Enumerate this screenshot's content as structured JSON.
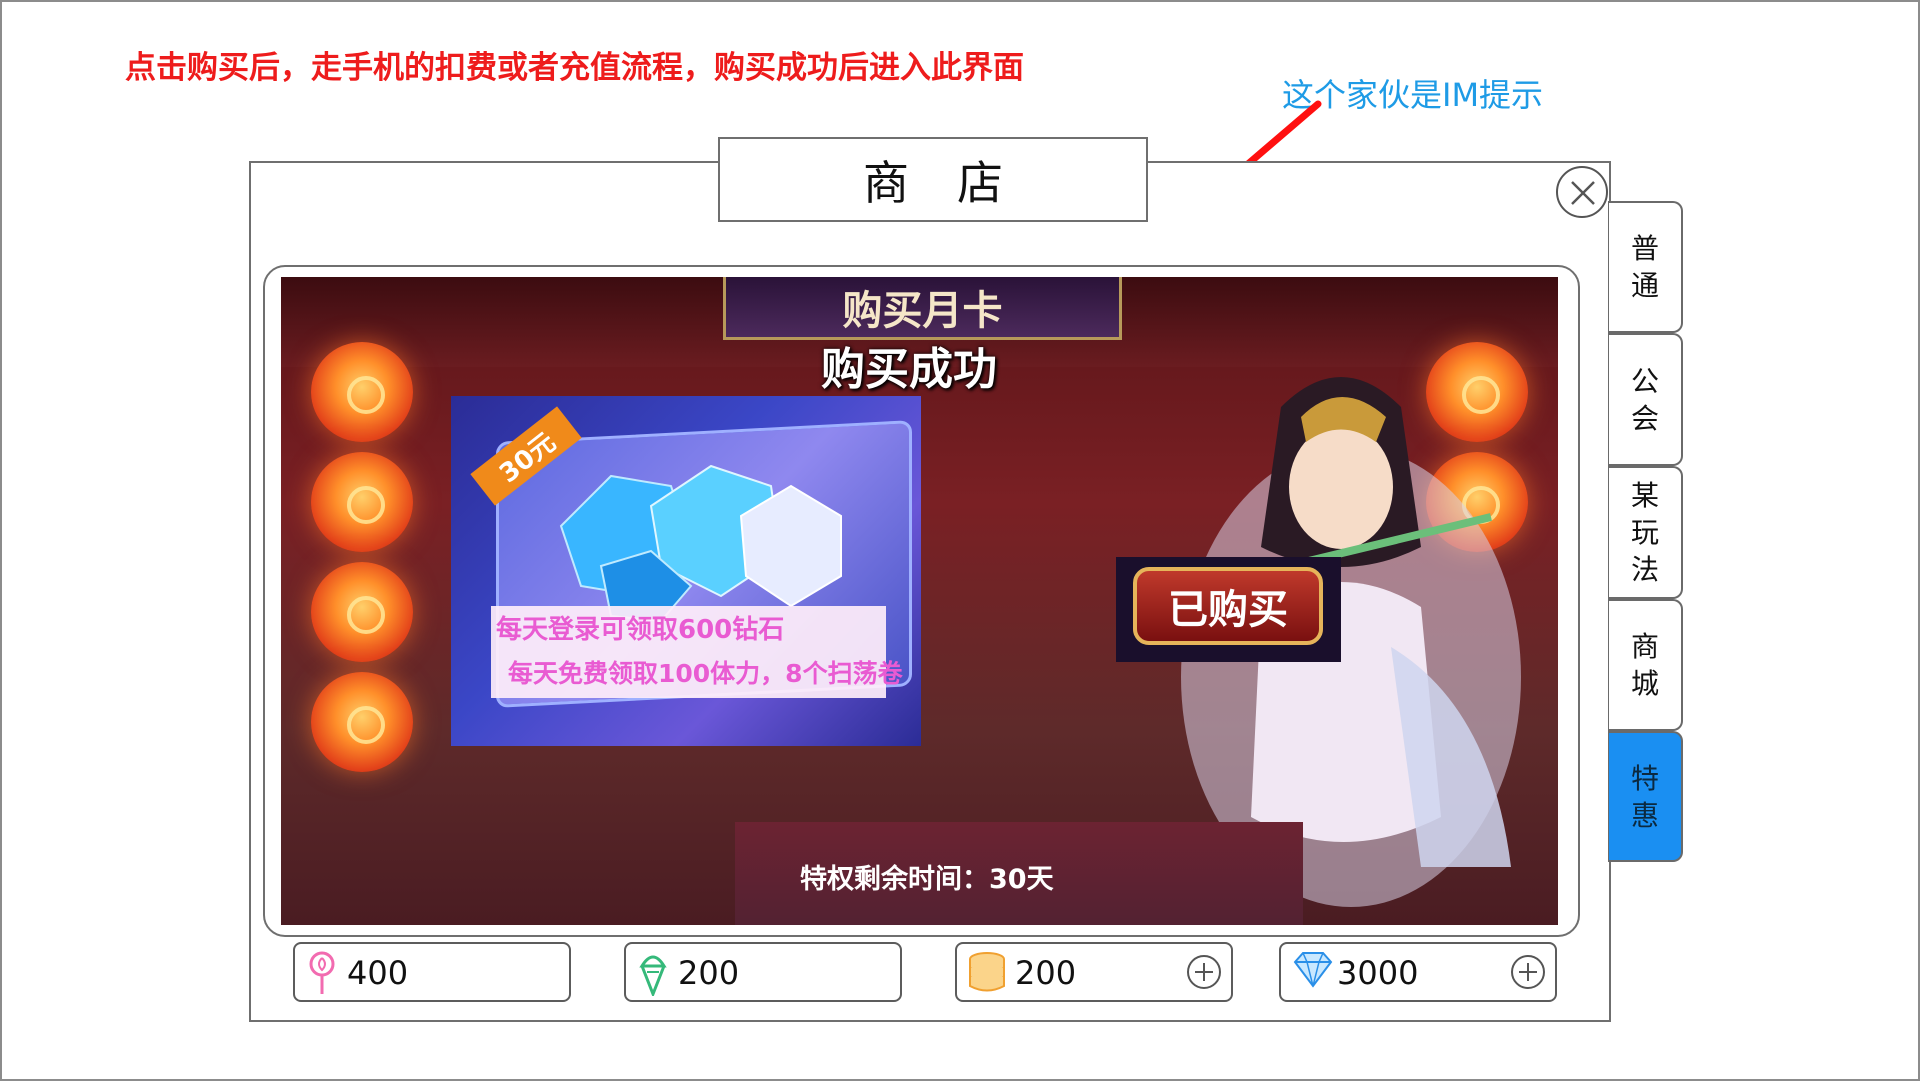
{
  "annotations": {
    "red_note": "点击购买后，走手机的扣费或者充值流程，购买成功后进入此界面",
    "blue_note": "这个家伙是IM提示"
  },
  "dialog": {
    "title": "商店"
  },
  "side_tabs": [
    {
      "label": "普通",
      "active": false
    },
    {
      "label": "公会",
      "active": false
    },
    {
      "label": "某玩法",
      "active": false
    },
    {
      "label": "商城",
      "active": false
    },
    {
      "label": "特惠",
      "active": true
    }
  ],
  "banner": {
    "sign": "购买月卡",
    "success": "购买成功",
    "card": {
      "price": "30元",
      "line1": "每天登录可领取600钻石",
      "line2": "每天免费领取100体力，8个扫荡卷"
    },
    "bought_button": "已购买",
    "remaining": "特权剩余时间：30天"
  },
  "currencies": [
    {
      "icon": "lollipop-icon",
      "value": "400",
      "has_plus": false
    },
    {
      "icon": "ice-cream-icon",
      "value": "200",
      "has_plus": false
    },
    {
      "icon": "coin-stack-icon",
      "value": "200",
      "has_plus": true
    },
    {
      "icon": "diamond-icon",
      "value": "3000",
      "has_plus": true
    }
  ],
  "colors": {
    "note_red": "#ee1c1c",
    "note_blue": "#1e9be6",
    "active_tab": "#1a8ff2",
    "info_pink": "#e95bd2"
  }
}
